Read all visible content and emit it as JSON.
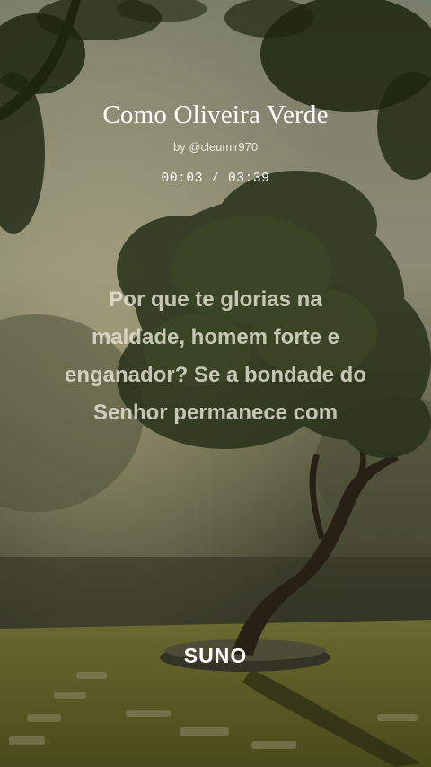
{
  "player": {
    "title": "Como Oliveira Verde",
    "author": "by @cleumir970",
    "time_current": "00:03",
    "time_separator": " / ",
    "time_total": "03:39",
    "progress_fraction": 0.014
  },
  "lyrics": [
    "Por que te glorias na",
    "maldade, homem forte e",
    "enganador? Se a bondade do",
    "Senhor permanece com"
  ],
  "brand": {
    "logo_text": "SUNO"
  },
  "colors": {
    "sky": "#a9a58a",
    "foliage": "#2c3a1e",
    "grass": "#8a8a3a",
    "text": "#ffffff"
  }
}
